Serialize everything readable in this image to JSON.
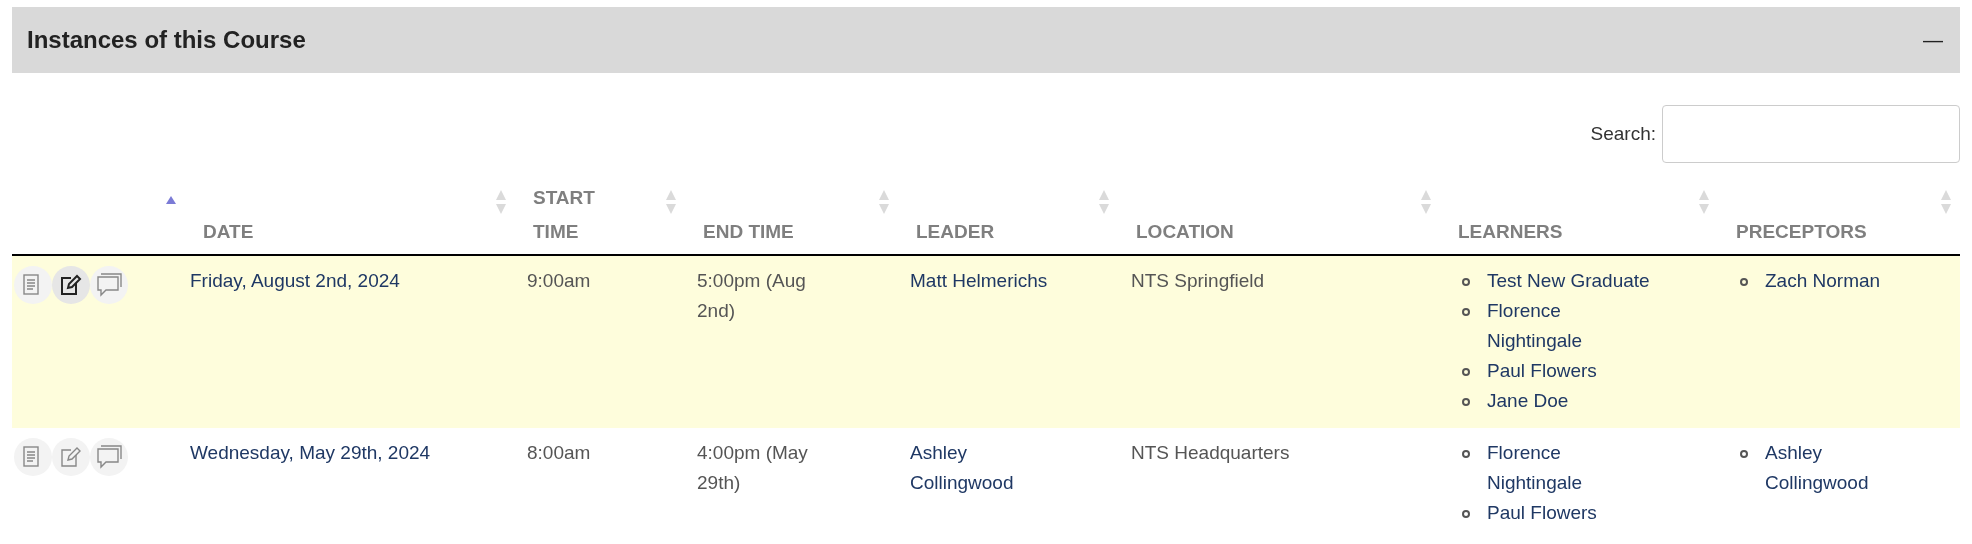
{
  "panel": {
    "title": "Instances of this Course",
    "collapse_icon": "—"
  },
  "search": {
    "label": "Search:"
  },
  "table": {
    "columns": [
      {
        "sorted": true
      },
      {
        "label": "DATE",
        "sorted": false
      },
      {
        "label": "START TIME",
        "sorted": false
      },
      {
        "label": "END TIME",
        "sorted": false
      },
      {
        "label": "LEADER",
        "sorted": false
      },
      {
        "label": "LOCATION",
        "sorted": false
      },
      {
        "label": "LEARNERS",
        "sorted": false
      },
      {
        "label": "PRECEPTORS",
        "sorted": false
      }
    ],
    "rows": [
      {
        "selected": true,
        "actions": [
          {
            "kind": "details",
            "active": false
          },
          {
            "kind": "edit",
            "active": true
          },
          {
            "kind": "comment",
            "active": false
          }
        ],
        "date": "Friday, August 2nd, 2024",
        "start": "9:00am",
        "end": "5:00pm (Aug 2nd)",
        "leader": "Matt Helmerichs",
        "location": "NTS Springfield",
        "learners": [
          "Test New Graduate",
          "Florence Nightingale",
          "Paul Flowers",
          "Jane Doe"
        ],
        "preceptors": [
          "Zach Norman"
        ]
      },
      {
        "selected": false,
        "actions": [
          {
            "kind": "details",
            "active": false
          },
          {
            "kind": "edit",
            "active": false
          },
          {
            "kind": "comment",
            "active": false
          }
        ],
        "date": "Wednesday, May 29th, 2024",
        "start": "8:00am",
        "end": "4:00pm (May 29th)",
        "leader": "Ashley Collingwood",
        "location": "NTS Headquarters",
        "learners": [
          "Florence Nightingale",
          "Paul Flowers"
        ],
        "preceptors": [
          "Ashley Collingwood"
        ]
      }
    ]
  }
}
